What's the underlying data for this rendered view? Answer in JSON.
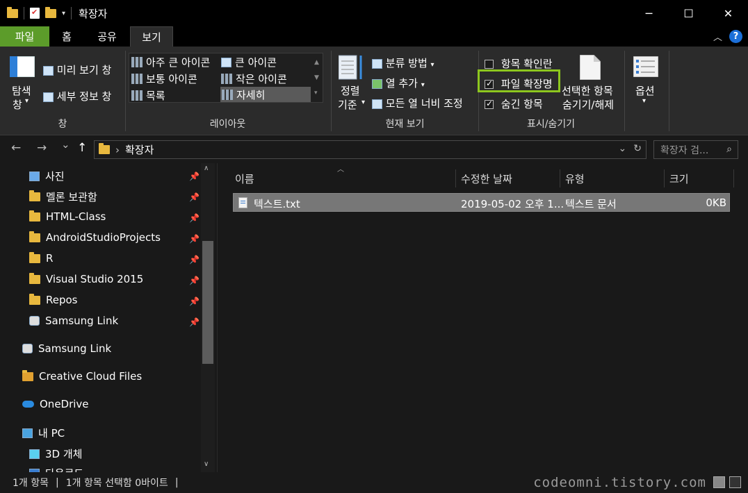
{
  "window": {
    "title": "확장자",
    "minimize": "─",
    "maximize": "☐",
    "close": "✕"
  },
  "quick_access": {
    "dropdown": "▾"
  },
  "tabs": {
    "file": "파일",
    "home": "홈",
    "share": "공유",
    "view": "보기",
    "collapse": "︿",
    "help": "?"
  },
  "ribbon": {
    "pane": {
      "nav_pane_line1": "탐색",
      "nav_pane_line2": "창",
      "preview": "미리 보기 창",
      "details": "세부 정보 창",
      "group": "창"
    },
    "layout": {
      "extra_large": "아주 큰 아이콘",
      "large": "큰 아이콘",
      "medium": "보통 아이콘",
      "small": "작은 아이콘",
      "list": "목록",
      "details": "자세히",
      "group": "레이아웃"
    },
    "current_view": {
      "sort_line1": "정렬",
      "sort_line2": "기준",
      "group_by": "분류 방법",
      "add_columns": "열 추가",
      "size_all_columns": "모든 열 너비 조정",
      "group": "현재 보기"
    },
    "show_hide": {
      "item_checkboxes": "항목 확인란",
      "item_checkboxes_checked": false,
      "file_extensions": "파일 확장명",
      "file_extensions_checked": true,
      "hidden_items": "숨긴 항목",
      "hidden_items_checked": true,
      "hide_selected_line1": "선택한 항목",
      "hide_selected_line2": "숨기기/해제",
      "group": "표시/숨기기"
    },
    "options": {
      "label": "옵션"
    }
  },
  "address": {
    "back": "←",
    "forward": "→",
    "recent": "⌄",
    "up": "↑",
    "path_sep": "›",
    "path": "확장자",
    "dropdown": "⌄",
    "refresh": "↻",
    "search_placeholder": "확장자 검...",
    "search_icon": "⌕"
  },
  "nav_pane": {
    "items": [
      {
        "label": "사진",
        "pinned": true
      },
      {
        "label": "멜론 보관함",
        "pinned": true
      },
      {
        "label": "HTML-Class",
        "pinned": true
      },
      {
        "label": "AndroidStudioProjects",
        "pinned": true
      },
      {
        "label": "R",
        "pinned": true
      },
      {
        "label": "Visual Studio 2015",
        "pinned": true
      },
      {
        "label": "Repos",
        "pinned": true
      },
      {
        "label": "Samsung Link",
        "pinned": true
      },
      {
        "label": "Samsung Link"
      },
      {
        "label": "Creative Cloud Files"
      },
      {
        "label": "OneDrive"
      },
      {
        "label": "내 PC"
      },
      {
        "label": "3D 개체"
      },
      {
        "label": "다운로드"
      }
    ],
    "pin_glyph": "📌"
  },
  "columns": {
    "name": "이름",
    "date": "수정한 날짜",
    "type": "유형",
    "size": "크기"
  },
  "files": [
    {
      "name": "텍스트.txt",
      "date": "2019-05-02 오후 1...",
      "type": "텍스트 문서",
      "size": "0KB"
    }
  ],
  "status": {
    "count": "1개 항목",
    "sep": "|",
    "selected": "1개 항목 선택함 0바이트",
    "sep2": "|"
  },
  "watermark": "codeomni.tistory.com",
  "colors": {
    "accent_file_tab": "#5c9c2a",
    "highlight_box": "#8dc71e",
    "help_blue": "#1c6fd8",
    "selected_row": "#777777"
  }
}
